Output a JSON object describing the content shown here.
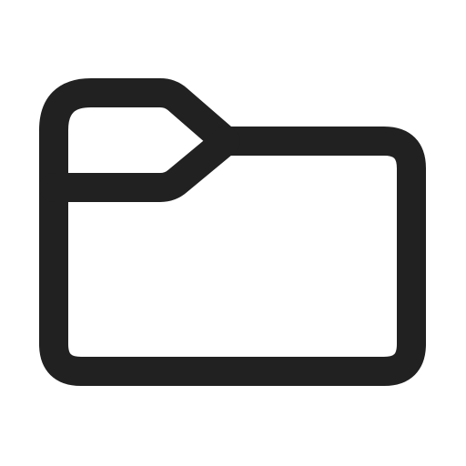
{
  "icon": {
    "name": "folder-icon",
    "stroke_color": "#212121",
    "background_color": "#ffffff"
  }
}
